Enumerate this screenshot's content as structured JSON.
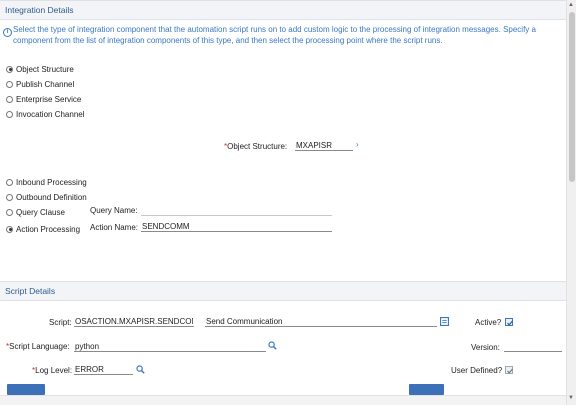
{
  "integration": {
    "title": "Integration Details",
    "info": "Select the type of integration component that the automation script runs on to add custom logic to the processing of integration messages. Specify a component from the list of integration components of this type, and then select the processing point where the script runs.",
    "types": [
      {
        "label": "Object Structure",
        "checked": true
      },
      {
        "label": "Publish Channel",
        "checked": false
      },
      {
        "label": "Enterprise Service",
        "checked": false
      },
      {
        "label": "Invocation Channel",
        "checked": false
      }
    ],
    "object_structure_label": "Object Structure:",
    "object_structure_value": "MXAPISR",
    "processing": [
      {
        "label": "Inbound Processing",
        "checked": false
      },
      {
        "label": "Outbound Definition",
        "checked": false
      },
      {
        "label": "Query Clause",
        "checked": false
      },
      {
        "label": "Action Processing",
        "checked": true
      }
    ],
    "query_name_label": "Query Name:",
    "query_name_value": "",
    "action_name_label": "Action Name:",
    "action_name_value": "SENDCOMM"
  },
  "script": {
    "title": "Script Details",
    "script_label": "Script:",
    "script_value": "OSACTION.MXAPISR.SENDCOMM",
    "description_value": "Send Communication",
    "active_label": "Active?",
    "active_checked": true,
    "language_label": "Script Language:",
    "language_value": "python",
    "version_label": "Version:",
    "version_value": "",
    "log_level_label": "Log Level:",
    "log_level_value": "ERROR",
    "user_defined_label": "User Defined?",
    "user_defined_checked": true
  },
  "icons": {
    "info": "info-icon",
    "chevron": "chevron-right-icon",
    "lookup": "magnifier-icon",
    "longdesc": "long-description-icon"
  },
  "colors": {
    "accent": "#3a78c2",
    "header_bg": "#f2f4f8",
    "required": "#d12c2c",
    "button": "#3c70b8"
  }
}
